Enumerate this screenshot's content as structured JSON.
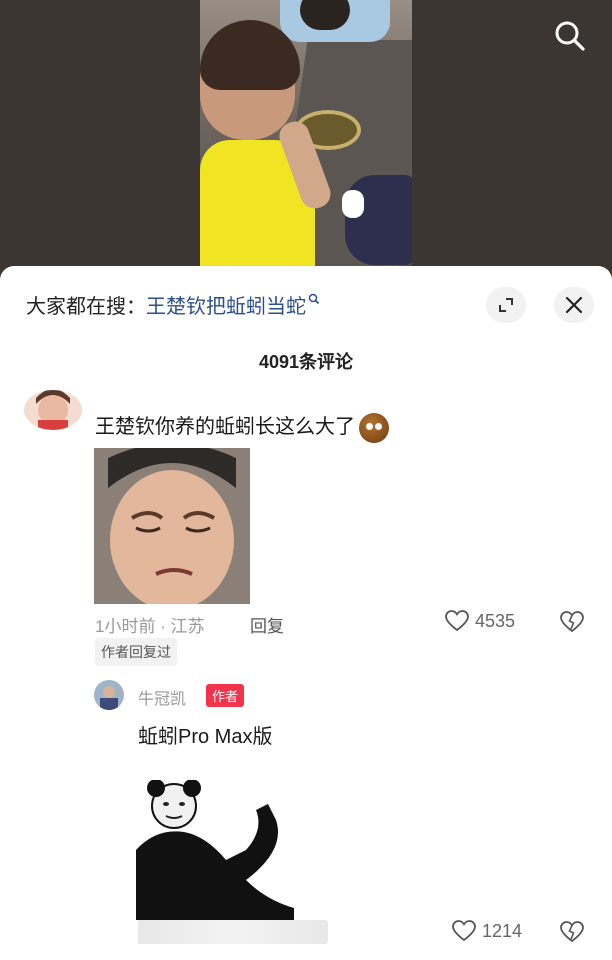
{
  "video": {
    "search_icon": "search-icon"
  },
  "sheet": {
    "hot_search_prefix": "大家都在搜：",
    "hot_search_keyword": "王楚钦把蚯蚓当蛇",
    "expand_icon": "expand-icon",
    "close_icon": "close-icon",
    "comment_count": "4091条评论"
  },
  "comments": [
    {
      "text": "王楚钦你养的蚯蚓长这么大了",
      "emoji": "grimace-emoji",
      "time_location": "1小时前 · 江苏",
      "reply_label": "回复",
      "likes": "4535",
      "author_replied": "作者回复过"
    }
  ],
  "reply": {
    "username": "牛冠凯",
    "badge": "作者",
    "text": "蚯蚓Pro Max版",
    "likes": "1214"
  },
  "colors": {
    "keyword": "#2a4f8f",
    "badge": "#f2334b"
  }
}
